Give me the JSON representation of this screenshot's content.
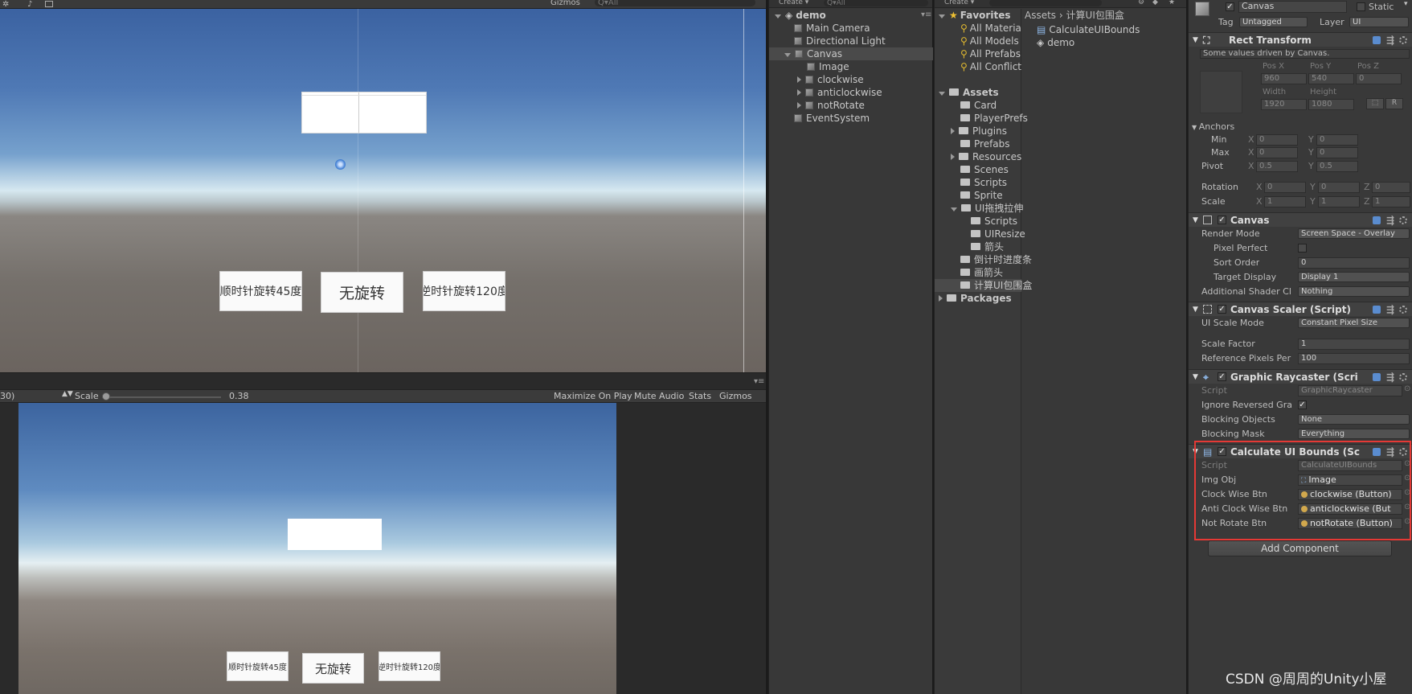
{
  "scene_toolbar": {
    "gizmos": "Gizmos",
    "search_placeholder": "Q▾All"
  },
  "scene": {
    "buttons": [
      {
        "label": "顺时针旋转45度"
      },
      {
        "label": "无旋转"
      },
      {
        "label": "逆时针旋转120度"
      }
    ]
  },
  "game_toolbar": {
    "resolution": "30)",
    "scale_label": "Scale",
    "scale_value": 0.38,
    "scale_value_text": "0.38",
    "maximize_on_play": "Maximize On Play",
    "mute_audio": "Mute Audio",
    "stats": "Stats",
    "gizmos": "Gizmos"
  },
  "game": {
    "buttons": [
      {
        "label": "顺时针旋转45度"
      },
      {
        "label": "无旋转"
      },
      {
        "label": "逆时针旋转120度"
      }
    ]
  },
  "hierarchy": {
    "create": "Create ▾",
    "search_placeholder": "Q▾All",
    "scene_name": "demo",
    "items": [
      {
        "label": "Main Camera"
      },
      {
        "label": "Directional Light"
      },
      {
        "label": "Canvas"
      },
      {
        "label": "Image"
      },
      {
        "label": "clockwise"
      },
      {
        "label": "anticlockwise"
      },
      {
        "label": "notRotate"
      },
      {
        "label": "EventSystem"
      }
    ]
  },
  "project": {
    "create": "Create ▾",
    "favorites_title": "Favorites",
    "favorites": [
      "All Materia",
      "All Models",
      "All Prefabs",
      "All Conflict"
    ],
    "assets_title": "Assets",
    "folders": [
      "Card",
      "PlayerPrefs",
      "Plugins",
      "Prefabs",
      "Resources",
      "Scenes",
      "Scripts",
      "Sprite",
      "UI拖拽拉伸",
      "Scripts",
      "UIResize",
      "箭头",
      "倒计时进度条",
      "画箭头",
      "计算UI包围盒"
    ],
    "packages_title": "Packages",
    "breadcrumb_root": "Assets",
    "breadcrumb_sep": "›",
    "breadcrumb_folder": "计算UI包围盒",
    "files": [
      "CalculateUIBounds",
      "demo"
    ]
  },
  "inspector": {
    "object_name": "Canvas",
    "static_label": "Static",
    "tag_label": "Tag",
    "tag_value": "Untagged",
    "layer_label": "Layer",
    "layer_value": "UI",
    "rect_transform": {
      "title": "Rect Transform",
      "note": "Some values driven by Canvas.",
      "pos_x_label": "Pos X",
      "pos_y_label": "Pos Y",
      "pos_z_label": "Pos Z",
      "pos_x": "960",
      "pos_y": "540",
      "pos_z": "0",
      "width_label": "Width",
      "height_label": "Height",
      "width": "1920",
      "height": "1080",
      "anchors_label": "Anchors",
      "min_label": "Min",
      "max_label": "Max",
      "min_x": "0",
      "min_y": "0",
      "max_x": "0",
      "max_y": "0",
      "pivot_label": "Pivot",
      "pivot_x": "0.5",
      "pivot_y": "0.5",
      "rotation_label": "Rotation",
      "rot_x": "0",
      "rot_y": "0",
      "rot_z": "0",
      "scale_label": "Scale",
      "scale_x": "1",
      "scale_y": "1",
      "scale_z": "1",
      "x": "X",
      "y": "Y",
      "z": "Z",
      "r": "R"
    },
    "canvas": {
      "title": "Canvas",
      "render_mode_label": "Render Mode",
      "render_mode": "Screen Space - Overlay",
      "pixel_perfect_label": "Pixel Perfect",
      "sort_order_label": "Sort Order",
      "sort_order": "0",
      "target_display_label": "Target Display",
      "target_display": "Display 1",
      "shader_label": "Additional Shader Cl",
      "shader": "Nothing"
    },
    "canvas_scaler": {
      "title": "Canvas Scaler (Script)",
      "ui_scale_mode_label": "UI Scale Mode",
      "ui_scale_mode": "Constant Pixel Size",
      "scale_factor_label": "Scale Factor",
      "scale_factor": "1",
      "ref_ppu_label": "Reference Pixels Per",
      "ref_ppu": "100"
    },
    "graphic_raycaster": {
      "title": "Graphic Raycaster (Scri",
      "script_label": "Script",
      "script": "GraphicRaycaster",
      "ignore_label": "Ignore Reversed Gra",
      "blocking_objects_label": "Blocking Objects",
      "blocking_objects": "None",
      "blocking_mask_label": "Blocking Mask",
      "blocking_mask": "Everything"
    },
    "calc_bounds": {
      "title": "Calculate UI Bounds (Sc",
      "script_label": "Script",
      "script": "CalculateUIBounds",
      "img_obj_label": "Img Obj",
      "img_obj": "Image",
      "clock_label": "Clock Wise Btn",
      "clock": "clockwise (Button)",
      "anti_label": "Anti Clock Wise Btn",
      "anti": "anticlockwise (But",
      "not_label": "Not Rotate Btn",
      "not": "notRotate (Button)"
    },
    "add_component": "Add Component"
  },
  "watermark": "CSDN @周周的Unity小屋",
  "colors": {
    "highlight_box": "#e53935",
    "hierarchy_selected": "#4a4a4a"
  }
}
